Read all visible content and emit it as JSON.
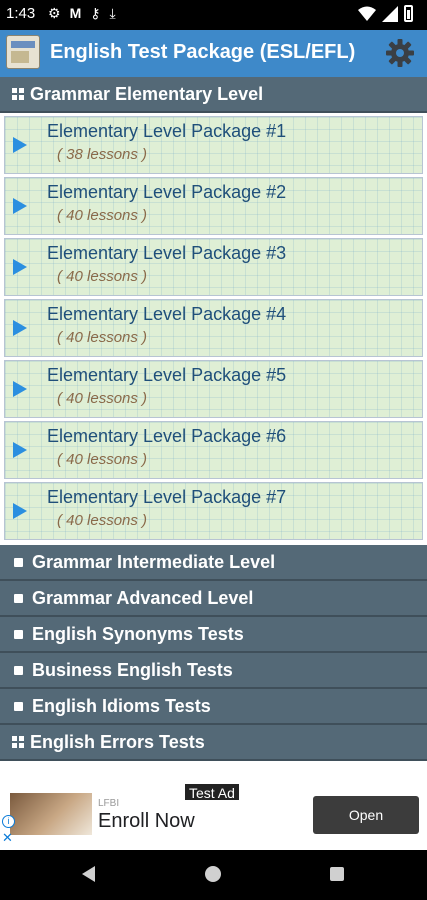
{
  "status_bar": {
    "time": "1:43",
    "left_icons": [
      "gear-icon",
      "gmail-icon",
      "key-icon",
      "download-icon"
    ],
    "right_icons": [
      "wifi-icon",
      "signal-icon",
      "battery-icon"
    ]
  },
  "app_bar": {
    "title": "English Test Package (ESL/EFL)",
    "logo_icon": "app-logo",
    "settings_icon": "gear-icon"
  },
  "sections": [
    {
      "label": "Grammar Elementary Level",
      "icon": "grid-icon",
      "expanded": true,
      "items": [
        {
          "name": "Elementary Level Package #1",
          "count": "( 38 lessons )"
        },
        {
          "name": "Elementary Level Package #2",
          "count": "( 40 lessons )"
        },
        {
          "name": "Elementary Level Package #3",
          "count": "( 40 lessons )"
        },
        {
          "name": "Elementary Level Package #4",
          "count": "( 40 lessons )"
        },
        {
          "name": "Elementary Level Package #5",
          "count": "( 40 lessons )"
        },
        {
          "name": "Elementary Level Package #6",
          "count": "( 40 lessons )"
        },
        {
          "name": "Elementary Level Package #7",
          "count": "( 40 lessons )"
        }
      ]
    },
    {
      "label": "Grammar Intermediate Level",
      "icon": "square-icon",
      "expanded": false
    },
    {
      "label": "Grammar Advanced Level",
      "icon": "square-icon",
      "expanded": false
    },
    {
      "label": "English Synonyms Tests",
      "icon": "square-icon",
      "expanded": false
    },
    {
      "label": "Business English Tests",
      "icon": "square-icon",
      "expanded": false
    },
    {
      "label": "English Idioms Tests",
      "icon": "square-icon",
      "expanded": false
    },
    {
      "label": "English Errors Tests",
      "icon": "grid-icon",
      "expanded": true
    }
  ],
  "ad": {
    "badge": "Test Ad",
    "sponsor": "LFBI",
    "headline": "Enroll Now",
    "button": "Open"
  },
  "colors": {
    "app_bar": "#3e89c9",
    "section_header": "#546977",
    "item_background": "#dfefd5",
    "item_text": "#1f4f7a",
    "arrow": "#2b8fe0"
  }
}
